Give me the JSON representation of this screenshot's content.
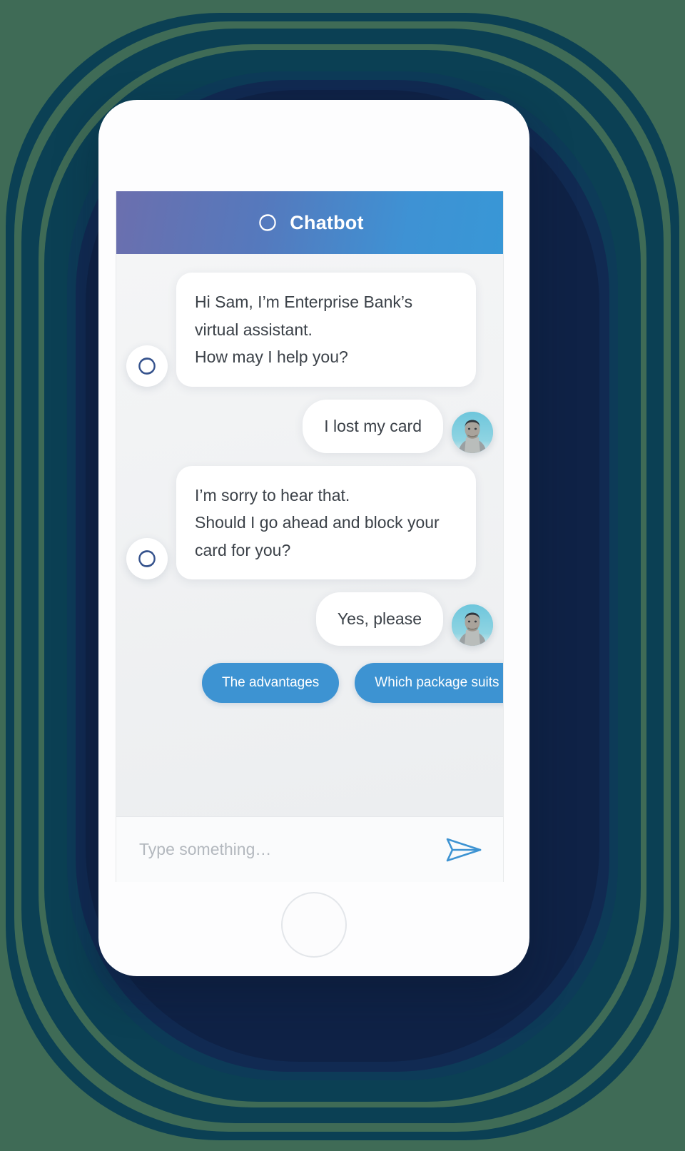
{
  "header": {
    "title": "Chatbot",
    "logo_icon": "orbit-logo-icon",
    "gradient_from": "#6b6fae",
    "gradient_to": "#3897d6"
  },
  "messages": [
    {
      "sender": "bot",
      "avatar_icon": "bot-orbit-avatar-icon",
      "lines": [
        "Hi Sam, I’m Enterprise Bank’s virtual assistant.",
        "How may I help you?"
      ]
    },
    {
      "sender": "user",
      "avatar_icon": "user-photo-avatar",
      "lines": [
        "I lost my card"
      ]
    },
    {
      "sender": "bot",
      "avatar_icon": "bot-orbit-avatar-icon",
      "lines": [
        "I’m sorry to hear that.",
        "Should I go ahead and block your card for you?"
      ]
    },
    {
      "sender": "user",
      "avatar_icon": "user-photo-avatar",
      "lines": [
        "Yes, please"
      ]
    }
  ],
  "quick_replies": [
    {
      "label": "The advantages"
    },
    {
      "label": "Which package suits me?"
    }
  ],
  "composer": {
    "placeholder": "Type something…",
    "value": "",
    "send_icon": "send-paper-plane-icon",
    "send_icon_color": "#3d93d2"
  },
  "device": {
    "home_button": "home-button",
    "body_color": "#fdfdfe"
  },
  "backdrop": {
    "ring_colors": [
      "#3f6b56",
      "#0b4054",
      "#0d3b58",
      "#112a52",
      "#0f2246"
    ]
  }
}
